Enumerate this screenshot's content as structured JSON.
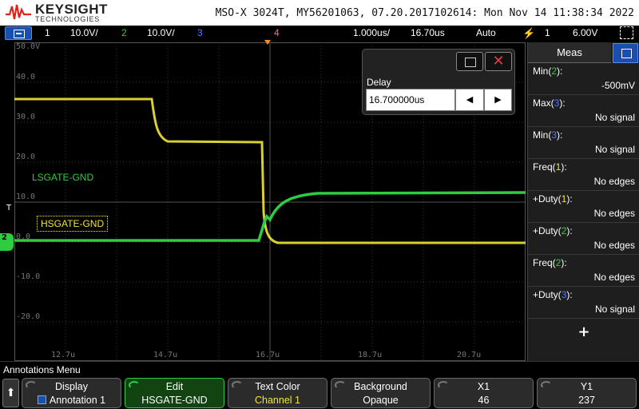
{
  "header": {
    "brand": "KEYSIGHT",
    "brand_sub": "TECHNOLOGIES",
    "info": "MSO-X 3024T, MY56201063, 07.20.2017102614: Mon Nov 14 11:38:34 2022"
  },
  "channel_bar": {
    "ch1_num": "1",
    "ch1_scale": "10.0V/",
    "ch2_num": "2",
    "ch2_scale": "10.0V/",
    "ch3_num": "3",
    "ch4_num": "4",
    "timebase": "1.000us/",
    "delay": "16.70us",
    "mode": "Auto",
    "trig_ch": "1",
    "trig_level": "6.00V",
    "colors": {
      "ch1": "#f2e535",
      "ch2": "#2ecc40",
      "ch3": "#4f7bff",
      "ch4": "#ff5fa8"
    }
  },
  "plot": {
    "y_labels": [
      "50.0V",
      "40.0",
      "30.0",
      "20.0",
      "10.0",
      "0.0",
      "-10.0",
      "-20.0"
    ],
    "x_labels": [
      "12.7u",
      "14.7u",
      "16.7u",
      "18.7u",
      "20.7u"
    ],
    "annotation_ls": "LSGATE-GND",
    "annotation_hs": "HSGATE-GND",
    "trig_marker": "T",
    "ch2_marker": "2"
  },
  "delay_dialog": {
    "label": "Delay",
    "value": "16.700000us",
    "left_icon": "◀",
    "right_icon": "▶",
    "close_icon": "✕"
  },
  "meas": {
    "title": "Meas",
    "items": [
      {
        "name": "Min(",
        "ch": "2",
        "color": "#2ecc40",
        "value": "-500mV"
      },
      {
        "name": "Max(",
        "ch": "3",
        "color": "#4f7bff",
        "value": "No signal"
      },
      {
        "name": "Min(",
        "ch": "3",
        "color": "#4f7bff",
        "value": "No signal"
      },
      {
        "name": "Freq(",
        "ch": "1",
        "color": "#f2e535",
        "value": "No edges"
      },
      {
        "name": "+Duty(",
        "ch": "1",
        "color": "#f2e535",
        "value": "No edges"
      },
      {
        "name": "+Duty(",
        "ch": "2",
        "color": "#2ecc40",
        "value": "No edges"
      },
      {
        "name": "Freq(",
        "ch": "2",
        "color": "#2ecc40",
        "value": "No edges"
      },
      {
        "name": "+Duty(",
        "ch": "3",
        "color": "#4f7bff",
        "value": "No signal"
      }
    ],
    "add": "+"
  },
  "menu": {
    "title": "Annotations Menu",
    "up_icon": "⬆",
    "softkeys": [
      {
        "l1": "Display",
        "l2": "Annotation 1"
      },
      {
        "l1": "Edit",
        "l2": "HSGATE-GND"
      },
      {
        "l1": "Text Color",
        "l2": "Channel 1"
      },
      {
        "l1": "Background",
        "l2": "Opaque"
      },
      {
        "l1": "X1",
        "l2": "46"
      },
      {
        "l1": "Y1",
        "l2": "237"
      }
    ]
  }
}
